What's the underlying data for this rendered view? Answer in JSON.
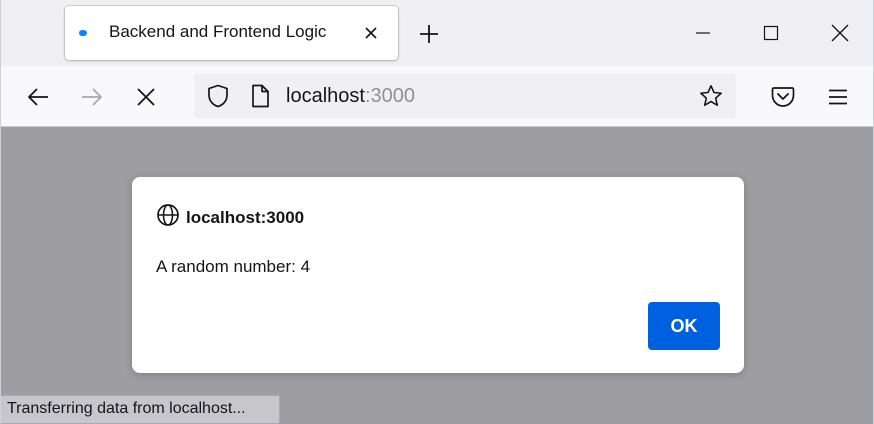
{
  "tab": {
    "title": "Backend and Frontend Logic",
    "close_icon": "close-icon"
  },
  "toolbar": {
    "back_icon": "arrow-left-icon",
    "forward_icon": "arrow-right-icon",
    "stop_icon": "stop-icon",
    "bookmark_icon": "star-icon",
    "pocket_icon": "pocket-icon",
    "menu_icon": "hamburger-menu-icon"
  },
  "urlbar": {
    "host": "localhost",
    "port": ":3000"
  },
  "dialog": {
    "origin": "localhost:3000",
    "message": "A random number: 4",
    "ok_label": "OK"
  },
  "status": {
    "text": "Transferring data from localhost..."
  },
  "colors": {
    "accent": "#0061e0",
    "loading": "#0a84ff",
    "overlay": "#9d9da2"
  }
}
